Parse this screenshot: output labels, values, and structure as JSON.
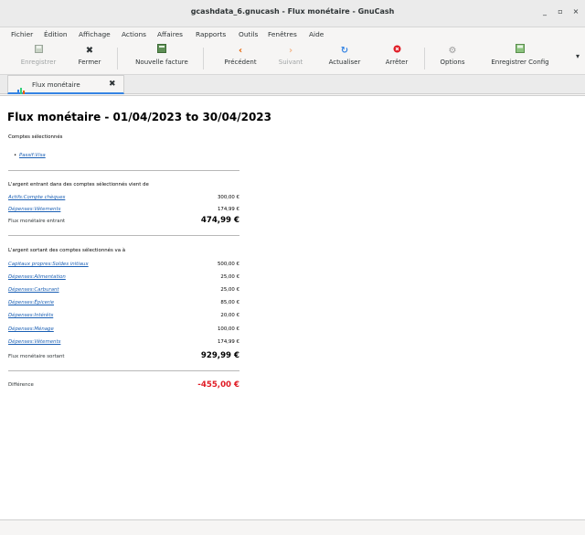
{
  "window": {
    "title": "gcashdata_6.gnucash - Flux monétaire - GnuCash",
    "minimize": "_",
    "maximize": "▫",
    "close": "×"
  },
  "menu": [
    "Fichier",
    "Édition",
    "Affichage",
    "Actions",
    "Affaires",
    "Rapports",
    "Outils",
    "Fenêtres",
    "Aide"
  ],
  "toolbar": {
    "save": "Enregistrer",
    "close": "Fermer",
    "new_invoice": "Nouvelle facture",
    "previous": "Précédent",
    "next": "Suivant",
    "refresh": "Actualiser",
    "stop": "Arrêter",
    "options": "Options",
    "save_config": "Enregistrer Config",
    "overflow": "▾"
  },
  "tab": {
    "label": "Flux monétaire",
    "close": "✖"
  },
  "report": {
    "title": "Flux monétaire - 01/04/2023 to 30/04/2023",
    "selected_label": "Comptes sélectionnés",
    "selected_account": "Passif:Visa",
    "in_label": "L'argent entrant dans des comptes sélectionnés vient de",
    "in_rows": [
      {
        "account": "Actifs:Compte chèques",
        "amount": "300,00 €"
      },
      {
        "account": "Dépenses:Vêtements",
        "amount": "174,99 €"
      }
    ],
    "in_total_label": "Flux monétaire entrant",
    "in_total": "474,99 €",
    "out_label": "L'argent sortant des comptes sélectionnés va à",
    "out_rows": [
      {
        "account": "Capitaux propres:Soldes initiaux",
        "amount": "500,00 €"
      },
      {
        "account": "Dépenses:Alimentation",
        "amount": "25,00 €"
      },
      {
        "account": "Dépenses:Carburant",
        "amount": "25,00 €"
      },
      {
        "account": "Dépenses:Épicerie",
        "amount": "85,00 €"
      },
      {
        "account": "Dépenses:Intérêts",
        "amount": "20,00 €"
      },
      {
        "account": "Dépenses:Ménage",
        "amount": "100,00 €"
      },
      {
        "account": "Dépenses:Vêtements",
        "amount": "174,99 €"
      }
    ],
    "out_total_label": "Flux monétaire sortant",
    "out_total": "929,99 €",
    "diff_label": "Différence",
    "diff_total": "-455,00 €"
  },
  "colors": {
    "link": "#1a5fb4",
    "negative": "#e01b24",
    "accent": "#3584e4"
  }
}
